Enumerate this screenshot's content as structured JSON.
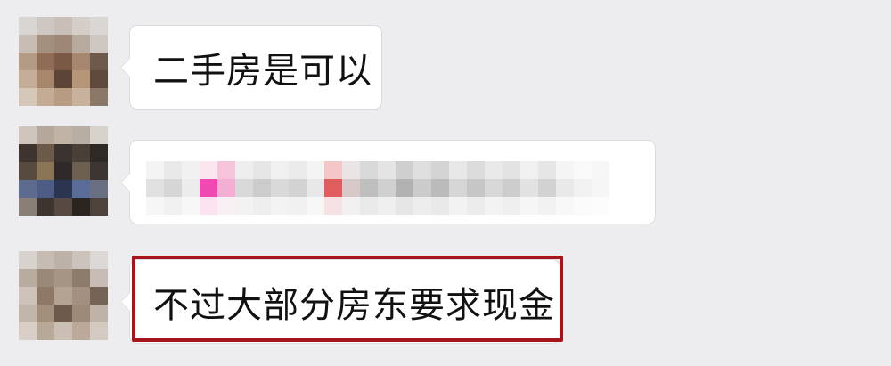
{
  "messages": [
    {
      "id": "msg1",
      "text": "二手房是可以",
      "highlighted": false
    },
    {
      "id": "msg2",
      "text": "",
      "pixelated": true,
      "highlighted": false
    },
    {
      "id": "msg3",
      "text": "不过大部分房东要求现金",
      "highlighted": true
    }
  ],
  "colors": {
    "background": "#edecef",
    "bubble": "#ffffff",
    "highlight_border": "#a6141c"
  }
}
